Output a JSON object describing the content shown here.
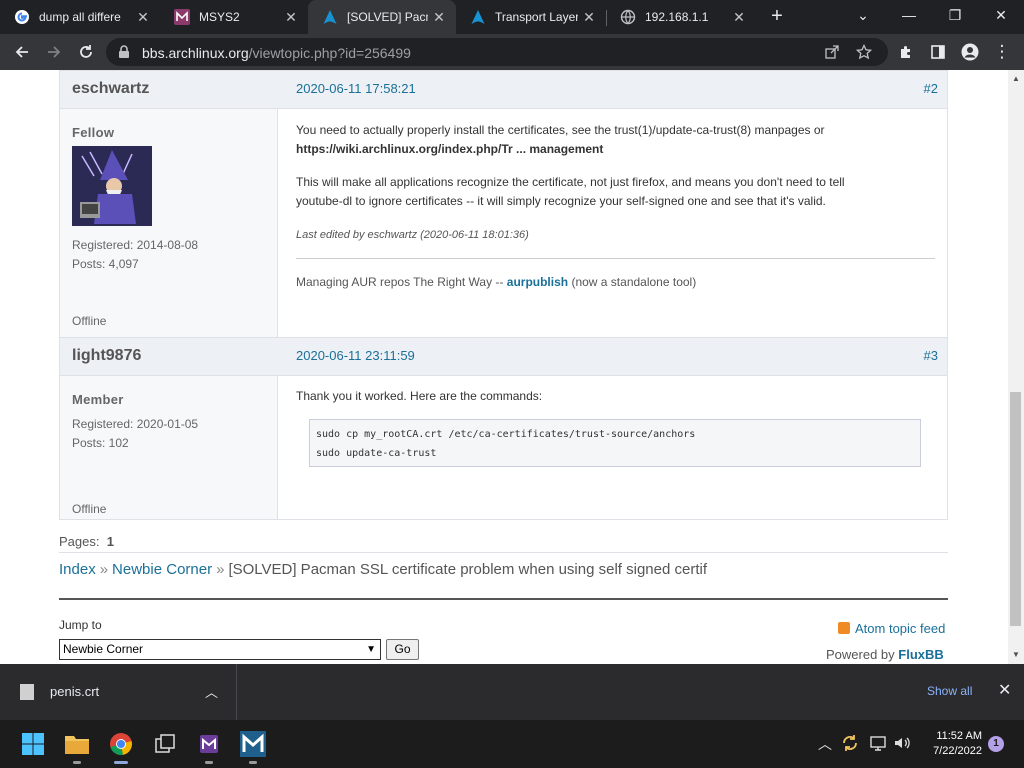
{
  "browser": {
    "tabs": [
      {
        "title": "dump all differe",
        "icon": "google-icon"
      },
      {
        "title": "MSYS2",
        "icon": "msys2-icon"
      },
      {
        "title": "[SOLVED] Pacm",
        "icon": "archlinux-icon",
        "active": true
      },
      {
        "title": "Transport Layer",
        "icon": "archlinux-icon"
      },
      {
        "title": "192.168.1.1",
        "icon": "globe-icon"
      }
    ],
    "new_tab": "+",
    "url_host": "bbs.archlinux.org",
    "url_path": "/viewtopic.php?id=256499"
  },
  "posts": [
    {
      "username": "eschwartz",
      "date": "2020-06-11 17:58:21",
      "number": "#2",
      "title": "Fellow",
      "registered": "Registered: 2014-08-08",
      "posts": "Posts: 4,097",
      "status": "Offline",
      "para1_a": "You need to actually properly install the certificates, see the trust(1)/update-ca-trust(8) manpages or",
      "para1_link": "https://wiki.archlinux.org/index.php/Tr ... management",
      "para2_a": "This will make all applications recognize the certificate, not just firefox, and means you don't need to tell",
      "para2_b": "youtube-dl to ignore certificates -- it will simply recognize your self-signed one and see that it's valid.",
      "edited": "Last edited by eschwartz (2020-06-11 18:01:36)",
      "sig_prefix": "Managing AUR repos The Right Way --",
      "sig_link": "aurpublish",
      "sig_suffix": "(now a standalone tool)"
    },
    {
      "username": "light9876",
      "date": "2020-06-11 23:11:59",
      "number": "#3",
      "title": "Member",
      "registered": "Registered: 2020-01-05",
      "posts": "Posts: 102",
      "status": "Offline",
      "text": "Thank you it worked. Here are the commands:",
      "code": [
        "sudo cp my_rootCA.crt /etc/ca-certificates/trust-source/anchors",
        "sudo update-ca-trust"
      ]
    }
  ],
  "pages_label": "Pages:",
  "pages_current": "1",
  "breadcrumb": {
    "index": "Index",
    "forum": "Newbie Corner",
    "topic": "[SOLVED] Pacman SSL certificate problem when using self signed certif",
    "sep": "»"
  },
  "jump": {
    "label": "Jump to",
    "selected": "Newbie Corner",
    "go": "Go"
  },
  "feed": "Atom topic feed",
  "powered_prefix": "Powered by",
  "powered_brand": "FluxBB",
  "download": {
    "file": "penis.crt",
    "show_all": "Show all"
  },
  "clock": {
    "time": "11:52 AM",
    "date": "7/22/2022"
  },
  "notifications": "1"
}
